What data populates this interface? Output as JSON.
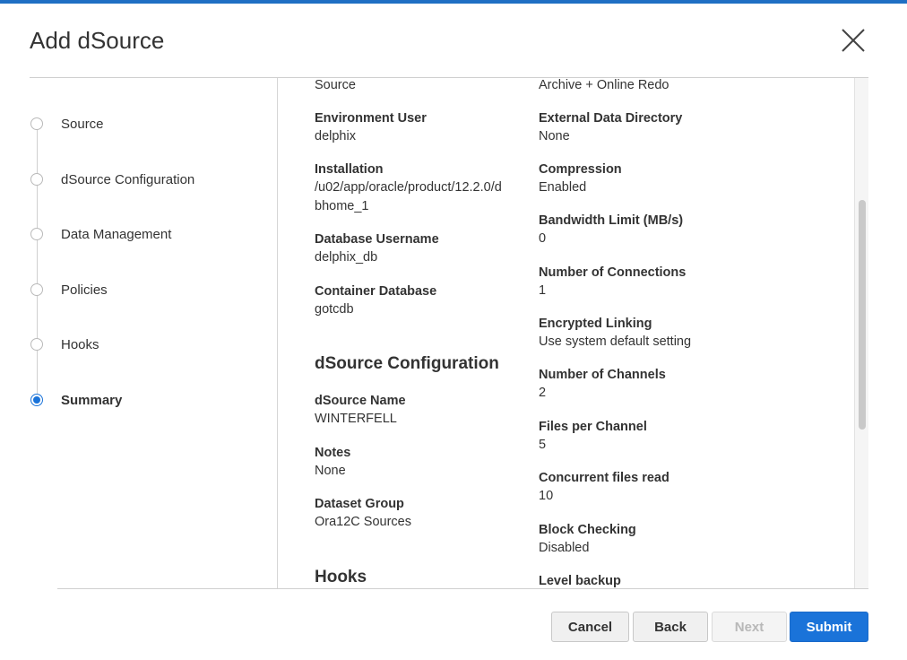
{
  "dialog": {
    "title": "Add dSource",
    "accent_color": "#1a73d9"
  },
  "steps": [
    {
      "label": "Source",
      "active": false
    },
    {
      "label": "dSource Configuration",
      "active": false
    },
    {
      "label": "Data Management",
      "active": false
    },
    {
      "label": "Policies",
      "active": false
    },
    {
      "label": "Hooks",
      "active": false
    },
    {
      "label": "Summary",
      "active": true
    }
  ],
  "summary": {
    "left": {
      "partial_value": "Source",
      "environment_user": {
        "label": "Environment User",
        "value": "delphix"
      },
      "installation": {
        "label": "Installation",
        "value_line1": "/u02/app/oracle/product/12.2.0/d",
        "value_line2": "bhome_1"
      },
      "database_username": {
        "label": "Database Username",
        "value": "delphix_db"
      },
      "container_database": {
        "label": "Container Database",
        "value": "gotcdb"
      },
      "dsource_config_heading": "dSource Configuration",
      "dsource_name": {
        "label": "dSource Name",
        "value": "WINTERFELL"
      },
      "notes": {
        "label": "Notes",
        "value": "None"
      },
      "dataset_group": {
        "label": "Dataset Group",
        "value": "Ora12C Sources"
      },
      "hooks_heading": "Hooks"
    },
    "right": {
      "partial_value": "Archive + Online Redo",
      "external_data_directory": {
        "label": "External Data Directory",
        "value": "None"
      },
      "compression": {
        "label": "Compression",
        "value": "Enabled"
      },
      "bandwidth_limit": {
        "label": "Bandwidth Limit (MB/s)",
        "value": "0"
      },
      "number_of_connections": {
        "label": "Number of Connections",
        "value": "1"
      },
      "encrypted_linking": {
        "label": "Encrypted Linking",
        "value": "Use system default setting"
      },
      "number_of_channels": {
        "label": "Number of Channels",
        "value": "2"
      },
      "files_per_channel": {
        "label": "Files per Channel",
        "value": "5"
      },
      "concurrent_files_read": {
        "label": "Concurrent files read",
        "value": "10"
      },
      "block_checking": {
        "label": "Block Checking",
        "value": "Disabled"
      },
      "level_backup": {
        "label": "Level backup"
      }
    }
  },
  "footer": {
    "cancel_label": "Cancel",
    "back_label": "Back",
    "next_label": "Next",
    "submit_label": "Submit"
  }
}
